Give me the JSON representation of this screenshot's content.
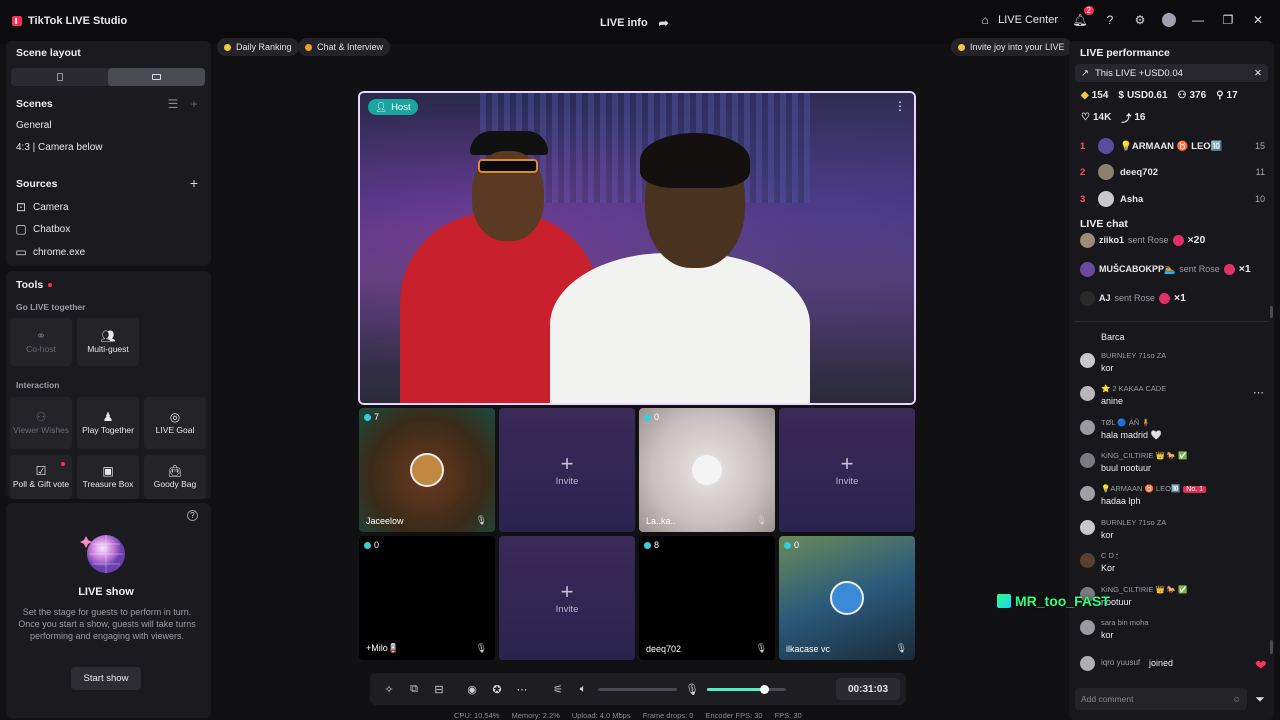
{
  "titlebar": {
    "app_name": "TikTok LIVE Studio",
    "center_title": "LIVE info",
    "live_center": "LIVE Center",
    "notif_count": "2"
  },
  "left": {
    "scene_layout": "Scene layout",
    "scenes_title": "Scenes",
    "scenes": [
      "General",
      "4:3 | Camera below"
    ],
    "sources_title": "Sources",
    "sources": [
      "Camera",
      "Chatbox",
      "chrome.exe"
    ],
    "tools_title": "Tools",
    "go_live_together": "Go LIVE together",
    "cohost": "Co-host",
    "multiguest": "Multi-guest",
    "interaction": "Interaction",
    "viewer_wishes": "Viewer Wishes",
    "play_together": "Play Together",
    "live_goal": "LIVE Goal",
    "poll_gift": "Poll & Gift vote",
    "treasure_box": "Treasure Box",
    "goody_bag": "Goody Bag",
    "show_title": "LIVE show",
    "show_desc": "Set the stage for guests to perform in turn. Once you start a show, guests will take turns performing and engaging with viewers.",
    "start_show": "Start show"
  },
  "chips": {
    "daily_ranking": "Daily Ranking",
    "chat_interview": "Chat & Interview",
    "invite_joy": "Invite joy into your LIVE"
  },
  "stage": {
    "host_label": "Host",
    "guests": [
      {
        "count": "7",
        "name": "Jaceelow",
        "type": "guest"
      },
      {
        "invite": "Invite",
        "type": "invite"
      },
      {
        "count": "0",
        "name": "La..ka..",
        "type": "guest"
      },
      {
        "invite": "Invite",
        "type": "invite"
      },
      {
        "count": "0",
        "name": "+Milo🪫",
        "type": "guest"
      },
      {
        "invite": "Invite",
        "type": "invite"
      },
      {
        "count": "8",
        "name": "deeq702",
        "type": "guest"
      },
      {
        "count": "0",
        "name": "ilkacase vc",
        "type": "guest"
      }
    ]
  },
  "controls": {
    "timer": "00:31:03",
    "volume_level": 0.0,
    "mic_level": 0.72
  },
  "stats": {
    "cpu": "CPU: 10.54%",
    "memory": "Memory: 2.2%",
    "upload": "Upload: 4.0 Mbps",
    "frame_drops": "Frame drops: 0",
    "encoder_fps": "Encoder FPS: 30",
    "fps": "FPS: 30"
  },
  "right": {
    "perf_title": "LIVE performance",
    "this_live": "This LIVE +USD0.04",
    "s_diamonds": "154",
    "s_usd": "USD0.61",
    "s_viewers": "376",
    "s_followers": "17",
    "s_likes": "14K",
    "s_shares": "16",
    "ranking": [
      {
        "rank": "1",
        "name": "💡ARMAAN ♉ LEO🔟",
        "value": "15"
      },
      {
        "rank": "2",
        "name": "deeq702",
        "value": "11"
      },
      {
        "rank": "3",
        "name": "Asha",
        "value": "10"
      }
    ],
    "chat_title": "LIVE chat",
    "gifts": [
      {
        "user": "ziiko1",
        "text": "sent Rose",
        "count": "×20"
      },
      {
        "user": "MUŠCABOKPP🏊",
        "text": "sent Rose",
        "count": "×1"
      },
      {
        "user": "AJ",
        "text": "sent Rose",
        "count": "×1"
      }
    ],
    "comments": [
      {
        "user": "",
        "text": "Barca"
      },
      {
        "user": "BURNLEY 71so ZA",
        "text": "kor"
      },
      {
        "user": "⭐ 2  KAKAA CADE",
        "text": "anine"
      },
      {
        "user": "TØL 🔵 ÀÑ 🧍",
        "text": "hala madrid 🤍"
      },
      {
        "user": "KiNG_CILTIRIE 👑 🐎 ✅",
        "text": "buul nootuur"
      },
      {
        "user": "💡ARMAAN ♉ LEO🔟",
        "text": "hadaa lph",
        "badge": "No. 1"
      },
      {
        "user": "BURNLEY 71so ZA",
        "text": "kor"
      },
      {
        "user": "C D 🕯",
        "text": "Kor"
      },
      {
        "user": "KiNG_CILTIRIE 👑 🐎 ✅",
        "text": "nootuur"
      },
      {
        "user": "sara bin moha",
        "text": "kor"
      },
      {
        "user": "iqro yuusuf",
        "text": "joined"
      }
    ],
    "add_comment": "Add comment"
  },
  "watermark": "MR_too_FAST"
}
